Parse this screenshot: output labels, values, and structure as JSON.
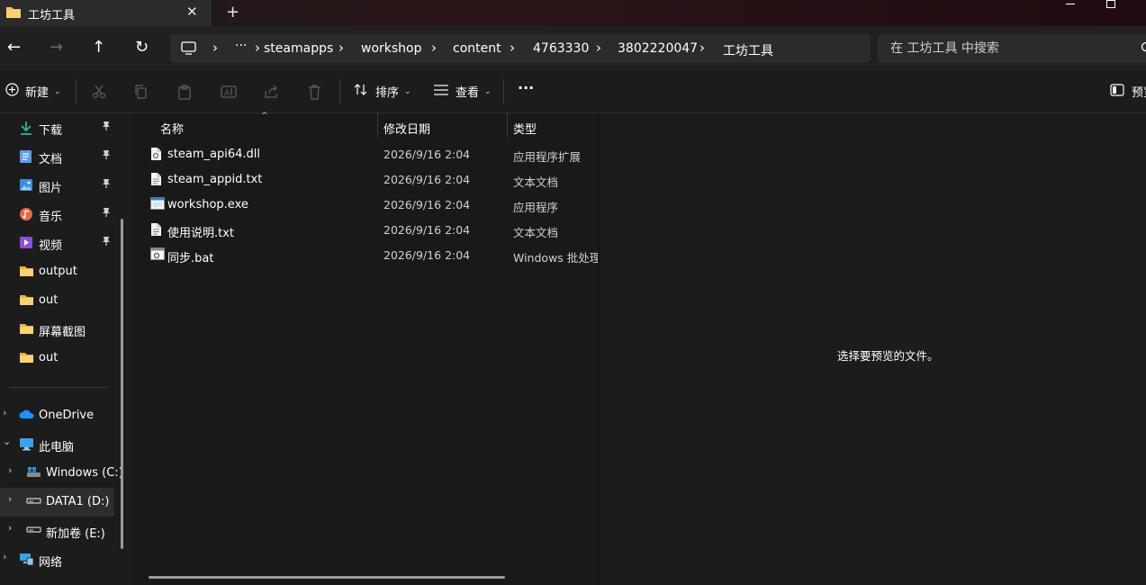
{
  "tab": {
    "title": "工坊工具",
    "close_glyph": "✕",
    "new_tab_glyph": "+"
  },
  "nav_buttons": {
    "back": "←",
    "forward": "→",
    "up": "↑",
    "refresh": "↻"
  },
  "breadcrumb": {
    "more": "···",
    "separator": "›",
    "items": [
      "steamapps",
      "workshop",
      "content",
      "4763330",
      "3802220047",
      "工坊工具"
    ]
  },
  "search": {
    "placeholder": "在 工坊工具 中搜索"
  },
  "commandbar": {
    "new_label": "新建",
    "sort_label": "排序",
    "view_label": "查看",
    "more_glyph": "···",
    "preview_label": "预览"
  },
  "sidebar": {
    "quick_access": [
      {
        "label": "下载",
        "icon": "download-icon",
        "pinned": true
      },
      {
        "label": "文档",
        "icon": "document-icon",
        "pinned": true
      },
      {
        "label": "图片",
        "icon": "picture-icon",
        "pinned": true
      },
      {
        "label": "音乐",
        "icon": "music-icon",
        "pinned": true
      },
      {
        "label": "视频",
        "icon": "video-icon",
        "pinned": true
      },
      {
        "label": "output",
        "icon": "folder-icon",
        "pinned": false
      },
      {
        "label": "out",
        "icon": "folder-icon",
        "pinned": false
      },
      {
        "label": "屏幕截图",
        "icon": "folder-icon",
        "pinned": false
      },
      {
        "label": "out",
        "icon": "folder-icon",
        "pinned": false
      }
    ],
    "tree": [
      {
        "label": "OneDrive",
        "icon": "onedrive-icon",
        "expanded": false
      },
      {
        "label": "此电脑",
        "icon": "computer-icon",
        "expanded": true
      },
      {
        "label": "Windows (C:)",
        "icon": "windows-drive-icon",
        "expanded": false
      },
      {
        "label": "DATA1 (D:)",
        "icon": "drive-icon",
        "expanded": false,
        "selected": true
      },
      {
        "label": "新加卷 (E:)",
        "icon": "drive-icon",
        "expanded": false
      },
      {
        "label": "网络",
        "icon": "network-icon",
        "expanded": false
      }
    ]
  },
  "file_list": {
    "columns": [
      "名称",
      "修改日期",
      "类型"
    ],
    "sort_glyph": "^",
    "rows": [
      {
        "name": "steam_api64.dll",
        "date": "2026/9/16 2:04",
        "type": "应用程序扩展",
        "icon": "dll-file-icon"
      },
      {
        "name": "steam_appid.txt",
        "date": "2026/9/16 2:04",
        "type": "文本文档",
        "icon": "text-file-icon"
      },
      {
        "name": "workshop.exe",
        "date": "2026/9/16 2:04",
        "type": "应用程序",
        "icon": "exe-file-icon"
      },
      {
        "name": "使用说明.txt",
        "date": "2026/9/16 2:04",
        "type": "文本文档",
        "icon": "text-file-icon"
      },
      {
        "name": "同步.bat",
        "date": "2026/9/16 2:04",
        "type": "Windows 批处理",
        "icon": "bat-file-icon"
      }
    ]
  },
  "preview": {
    "message": "选择要预览的文件。"
  },
  "colors": {
    "accent": "#0078d4",
    "folder": "#f4c45a",
    "background": "#191919"
  }
}
